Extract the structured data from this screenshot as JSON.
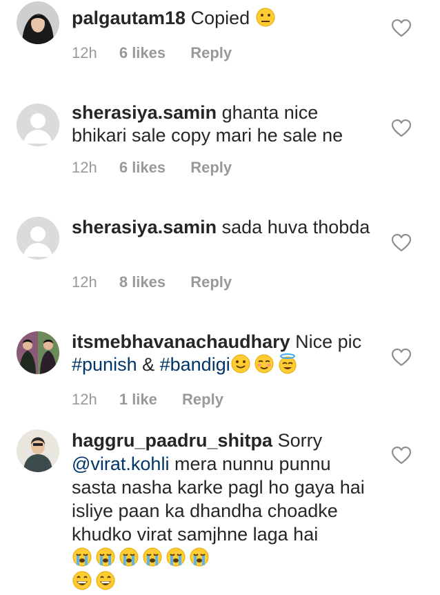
{
  "comments": [
    {
      "username": "palgautam18",
      "text": " Copied",
      "time": "12h",
      "likes": "6 likes",
      "reply": "Reply",
      "avatar": "profile-photo",
      "emoji": [
        "neutral-face-emoji"
      ]
    },
    {
      "username": "sherasiya.samin",
      "text": " ghanta nice bhikari sale copy mari he sale ne",
      "time": "12h",
      "likes": "6 likes",
      "reply": "Reply",
      "avatar": "default-avatar"
    },
    {
      "username": "sherasiya.samin",
      "text": " sada huva thobda",
      "time": "12h",
      "likes": "8 likes",
      "reply": "Reply",
      "avatar": "default-avatar"
    },
    {
      "username": "itsmebhavanachaudhary",
      "text_before": " Nice pic ",
      "tag1": "#punish",
      "mid": " & ",
      "tag2": "#bandigi",
      "time": "12h",
      "likes": "1 like",
      "reply": "Reply",
      "avatar": "profile-photo",
      "emoji": [
        "slightly-smiling-face-emoji",
        "smiling-face-emoji",
        "smiling-face-with-halo-emoji"
      ]
    },
    {
      "username": "haggru_paadru_shitpa",
      "text_before": " Sorry ",
      "mention": "@virat.kohli",
      "text_after": " mera nunnu punnu sasta nasha karke pagl ho gaya hai isliye paan ka dhandha choadke khudko virat samjhne laga hai",
      "avatar": "profile-photo",
      "emoji": [
        "loudly-crying-face-emoji",
        "loudly-crying-face-emoji",
        "loudly-crying-face-emoji",
        "loudly-crying-face-emoji",
        "loudly-crying-face-emoji",
        "loudly-crying-face-emoji",
        "grinning-face-emoji",
        "grinning-face-emoji"
      ]
    }
  ],
  "colors": {
    "username": "#262626",
    "meta": "#999999",
    "hashtag": "#003569",
    "heart": "#8e8e8e"
  },
  "icons": {
    "like": "heart-outline-icon"
  }
}
